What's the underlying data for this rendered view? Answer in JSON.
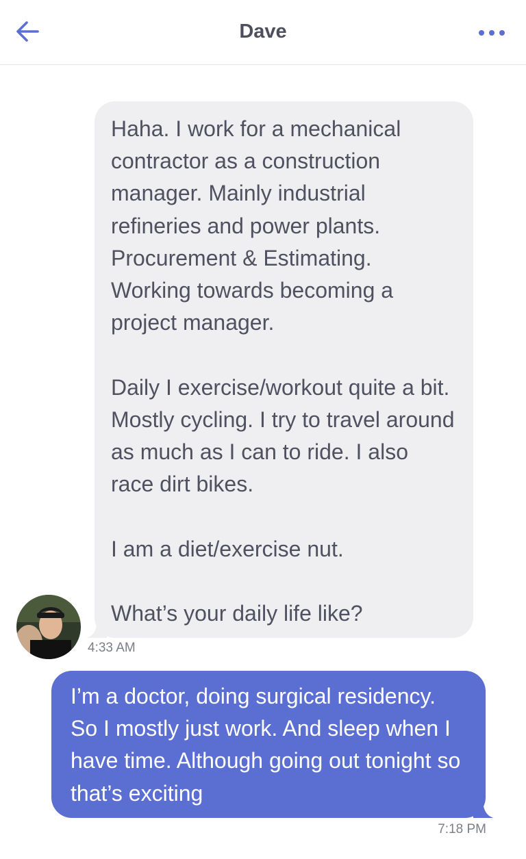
{
  "header": {
    "title": "Dave",
    "back_icon": "arrow-left-icon",
    "more_icon": "more-horizontal-icon",
    "accent_color": "#5b6ed1"
  },
  "messages": [
    {
      "direction": "incoming",
      "text": "Haha. I work for a mechanical contractor as a construction manager. Mainly industrial refineries and power plants. Procurement & Estimating. Working towards becoming a project manager.\n\nDaily I exercise/workout quite a bit. Mostly cycling. I try to travel around as much as I can to ride. I also race dirt bikes.\n\nI am a diet/exercise nut.\n\nWhat’s your daily life like?",
      "time": "4:33 AM",
      "bubble_color": "#efeff1"
    },
    {
      "direction": "outgoing",
      "text": "I’m a doctor, doing surgical residency. So I mostly just work. And sleep when I have time. Although going out tonight so that’s exciting",
      "time": "7:18 PM",
      "bubble_color": "#5b6ed1"
    }
  ]
}
